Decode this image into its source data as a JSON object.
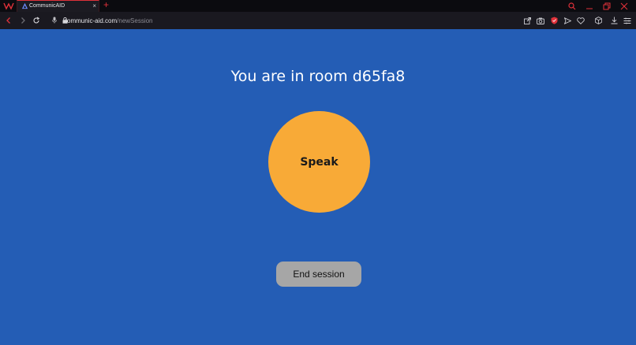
{
  "browser": {
    "tab": {
      "title": "CommunicAID",
      "close_glyph": "×"
    },
    "new_tab_glyph": "+",
    "address": {
      "host": "communic-aid.com",
      "path": "/newSession"
    }
  },
  "page": {
    "title": "You are in room d65fa8",
    "speak_label": "Speak",
    "end_label": "End session"
  },
  "colors": {
    "page_background": "#245db5",
    "speak_button": "#f8aa37",
    "end_button": "#a6a6a6",
    "browser_accent": "#e0313a"
  },
  "icons": [
    "browser-logo-icon",
    "tab-favicon-icon",
    "search-icon",
    "minimize-icon",
    "restore-icon",
    "close-window-icon",
    "back-icon",
    "forward-icon",
    "reload-icon",
    "mic-icon",
    "lock-icon",
    "share-icon",
    "camera-icon",
    "shield-icon",
    "send-icon",
    "heart-icon",
    "cube-icon",
    "download-icon",
    "menu-icon"
  ]
}
